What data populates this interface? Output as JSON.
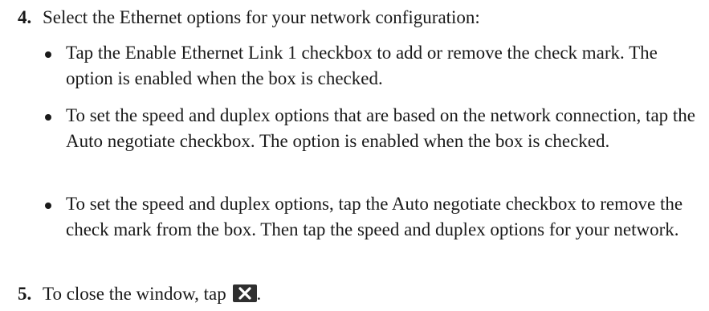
{
  "steps": [
    {
      "number": "4.",
      "text": "Select the Ethernet options for your network configuration:",
      "bullets": [
        "Tap the Enable Ethernet Link 1 checkbox to add or remove the check mark. The option is enabled when the box is checked.",
        "To set the speed and duplex options that are based on the network connection, tap the Auto negotiate checkbox. The option is enabled when the box is checked.",
        "To set the speed and duplex options, tap the Auto negotiate checkbox to remove the check mark from the box. Then tap the speed and duplex options for your network."
      ]
    },
    {
      "number": "5.",
      "text": "To close the window, tap",
      "trailing_punct": ".",
      "inline_icon": "close-icon"
    }
  ]
}
